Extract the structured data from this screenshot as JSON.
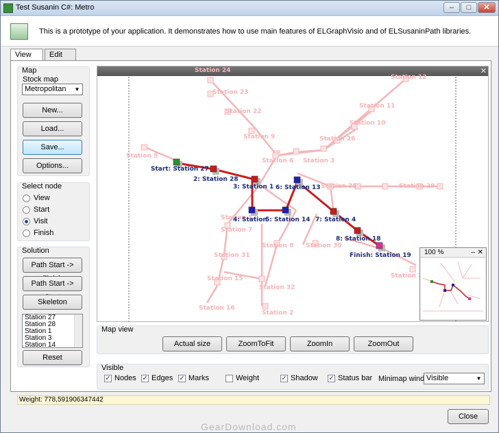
{
  "window": {
    "title": "Test Susanin C#: Metro",
    "minimize": "–",
    "maximize": "□",
    "close": "✕"
  },
  "header": {
    "text": "This is a prototype of your application. It demonstrates how to use main features of ELGraphVisio and of ELSusaninPath libraries."
  },
  "tabs": [
    {
      "label": "View map"
    },
    {
      "label": "Edit map"
    }
  ],
  "map_group": {
    "label": "Map",
    "stock_map_label": "Stock map",
    "stock_map_value": "Metropolitan",
    "buttons": {
      "new": "New...",
      "load": "Load...",
      "save": "Save...",
      "options": "Options..."
    }
  },
  "select_node": {
    "label": "Select node",
    "options": [
      {
        "label": "View",
        "selected": false
      },
      {
        "label": "Start",
        "selected": false
      },
      {
        "label": "Visit",
        "selected": true
      },
      {
        "label": "Finish",
        "selected": false
      }
    ]
  },
  "solution": {
    "label": "Solution",
    "buttons": {
      "path_finish": "Path Start -> Finish",
      "path_start": "Path Start -> Start",
      "skeleton": "Skeleton",
      "reset": "Reset"
    },
    "list": [
      "Station 27",
      "Station 28",
      "Station 1",
      "Station 3",
      "Station 14"
    ]
  },
  "map_view": {
    "label": "Map view",
    "buttons": {
      "actual_size": "Actual size",
      "zoom_fit": "ZoomToFit",
      "zoom_in": "ZoomIn",
      "zoom_out": "ZoomOut"
    }
  },
  "visible": {
    "label": "Visible",
    "checks": [
      {
        "label": "Nodes",
        "checked": true
      },
      {
        "label": "Edges",
        "checked": true
      },
      {
        "label": "Marks",
        "checked": true
      },
      {
        "label": "Weight",
        "checked": false
      },
      {
        "label": "Shadow",
        "checked": true
      },
      {
        "label": "Status bar",
        "checked": true
      }
    ],
    "minimap_label": "Minimap window",
    "minimap_value": "Visible"
  },
  "minimap": {
    "zoom": "100 %",
    "minimize": "–",
    "close": "✕"
  },
  "status": {
    "weight": "Weight: 778,591906347442"
  },
  "close_button": "Close",
  "watermark": "GearDownload.com",
  "map": {
    "faded_labels": [
      "Station 24",
      "Station 12",
      "Station 23",
      "Station 11",
      "Station 22",
      "Station 10",
      "Station 9",
      "Station 26",
      "Station 5",
      "Station 6",
      "Station 3",
      "Station 35",
      "Station 29",
      "Station 7",
      "Station 8",
      "Station 30",
      "Station 31",
      "Station 15",
      "Station 32",
      "Station 16",
      "Station 2"
    ],
    "path_labels": [
      "Start: Station 27",
      "2: Station 28",
      "3: Station 1",
      "6: Station 13",
      "4: Station",
      "5: Station 14",
      "7: Station 4",
      "8: Station 18",
      "Finish: Station 19"
    ],
    "colors": {
      "faded": "#f4b6b8",
      "path": "#cc1b1b",
      "visit": "#1f1fb8",
      "start": "#2f8f2f",
      "finish": "#d6319a",
      "label": "#1a2a7a"
    }
  }
}
